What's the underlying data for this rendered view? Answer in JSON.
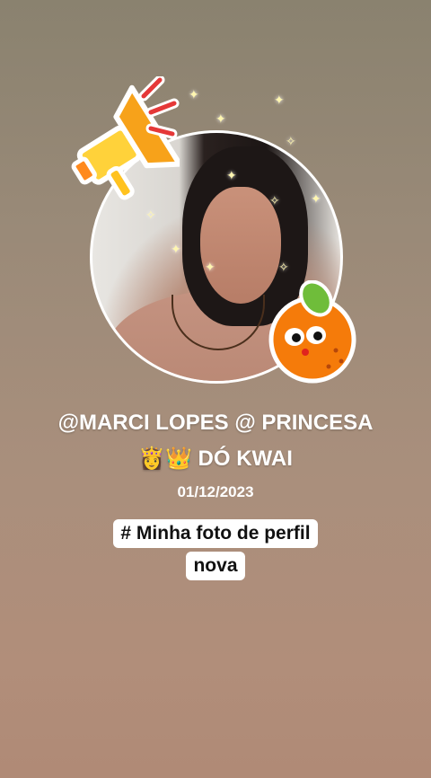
{
  "profile": {
    "handle_line1": "@MARCI LOPES @ PRINCESA",
    "handle_line2": "👸👑 DÓ KWAI",
    "date": "01/12/2023"
  },
  "caption": {
    "line1": "# Minha foto de perfil",
    "line2": "nova"
  },
  "stickers": {
    "megaphone": "megaphone-icon",
    "orange": "orange-icon"
  },
  "colors": {
    "background_top": "#8a826f",
    "background_bottom": "#b08a76",
    "text": "#ffffff",
    "caption_bg": "#ffffff"
  }
}
